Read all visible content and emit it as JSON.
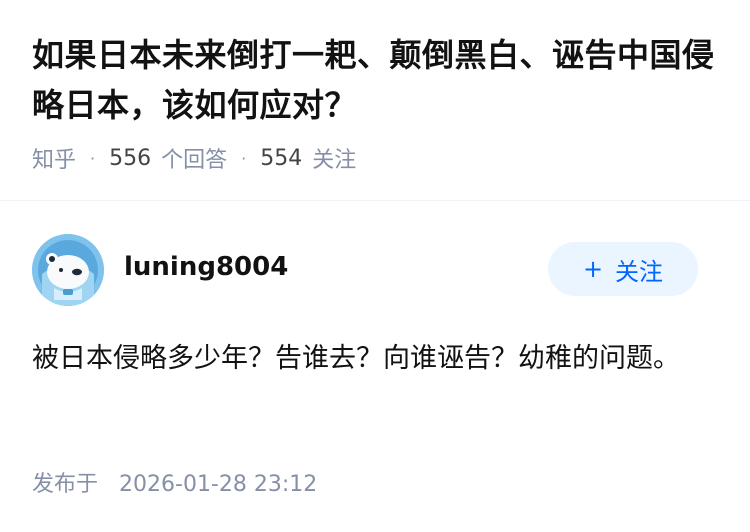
{
  "question": {
    "title": "如果日本未来倒打一耙、颠倒黑白、诬告中国侵略日本，该如何应对？",
    "source": "知乎",
    "separator": "·",
    "answer_count": "556",
    "answer_label": "个回答",
    "follower_count": "554",
    "follower_label": "关注"
  },
  "author": {
    "name": "luning8004",
    "avatar_icon": "polar-bear-astronaut-avatar",
    "follow_button": {
      "icon": "+",
      "label": "关注"
    }
  },
  "answer": {
    "content": "被日本侵略多少年？告谁去？向谁诬告？幼稚的问题。",
    "publish_label": "发布于",
    "publish_time": "2026-01-28 23:12"
  },
  "colors": {
    "accent": "#0066ff",
    "follow_bg": "#ebf5ff",
    "meta_text": "#8590a6",
    "title_text": "#121212"
  }
}
